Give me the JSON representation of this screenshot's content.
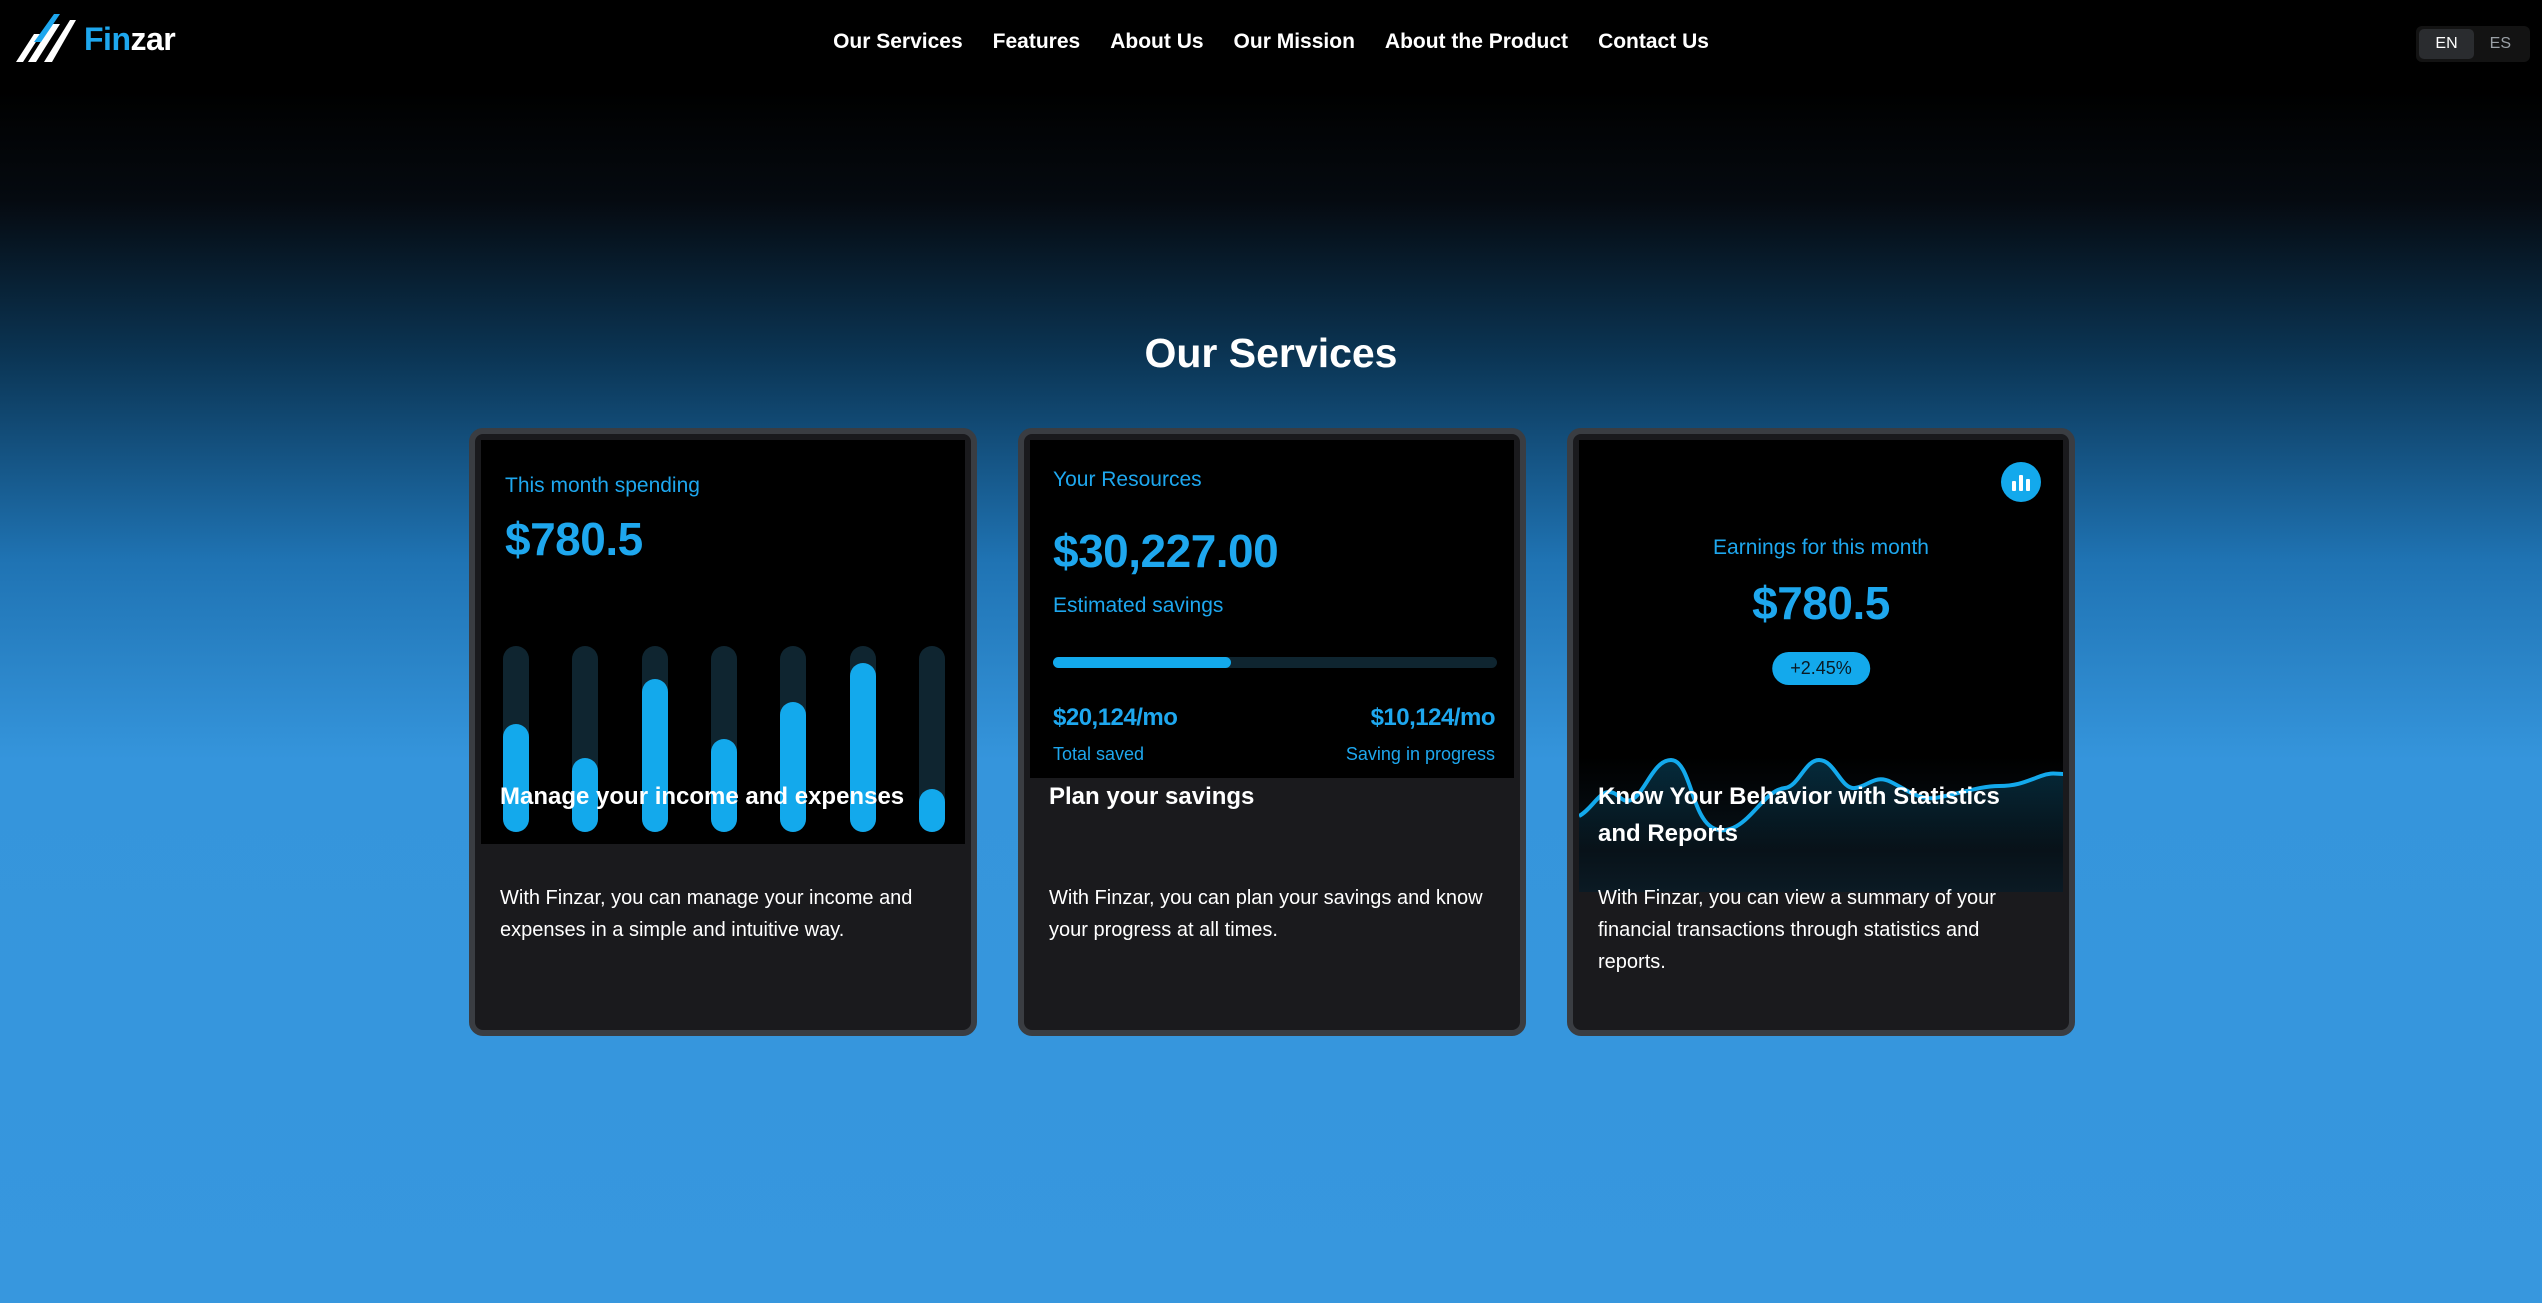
{
  "brand": {
    "name_part1": "Fin",
    "name_part2": "zar",
    "accent": "#1ea7ee"
  },
  "nav": {
    "items": [
      "Our Services",
      "Features",
      "About Us",
      "Our Mission",
      "About the Product",
      "Contact Us"
    ],
    "languages": [
      "EN",
      "ES"
    ],
    "active_language": "EN"
  },
  "section": {
    "title": "Our Services"
  },
  "cards": [
    {
      "label": "This month spending",
      "amount": "$780.5",
      "bar_levels": [
        0.58,
        0.4,
        0.82,
        0.5,
        0.7,
        0.91,
        0.23
      ],
      "heading": "Manage your income and expenses",
      "description": "With Finzar, you can manage your income and expenses in a simple and intuitive way."
    },
    {
      "label": "Your Resources",
      "amount": "$30,227.00",
      "sublabel": "Estimated savings",
      "progress": 0.4,
      "left_value": "$20,124/mo",
      "left_caption": "Total saved",
      "right_value": "$10,124/mo",
      "right_caption": "Saving in progress",
      "heading": "Plan your savings",
      "description": "With Finzar, you can plan your savings and know your progress at all times."
    },
    {
      "icon": "bar-chart-icon",
      "label": "Earnings for this month",
      "amount": "$780.5",
      "badge": "+2.45%",
      "heading": "Know Your Behavior with Statistics and Reports",
      "description": "With Finzar, you can view a summary of your financial transactions through statistics and reports."
    }
  ]
}
